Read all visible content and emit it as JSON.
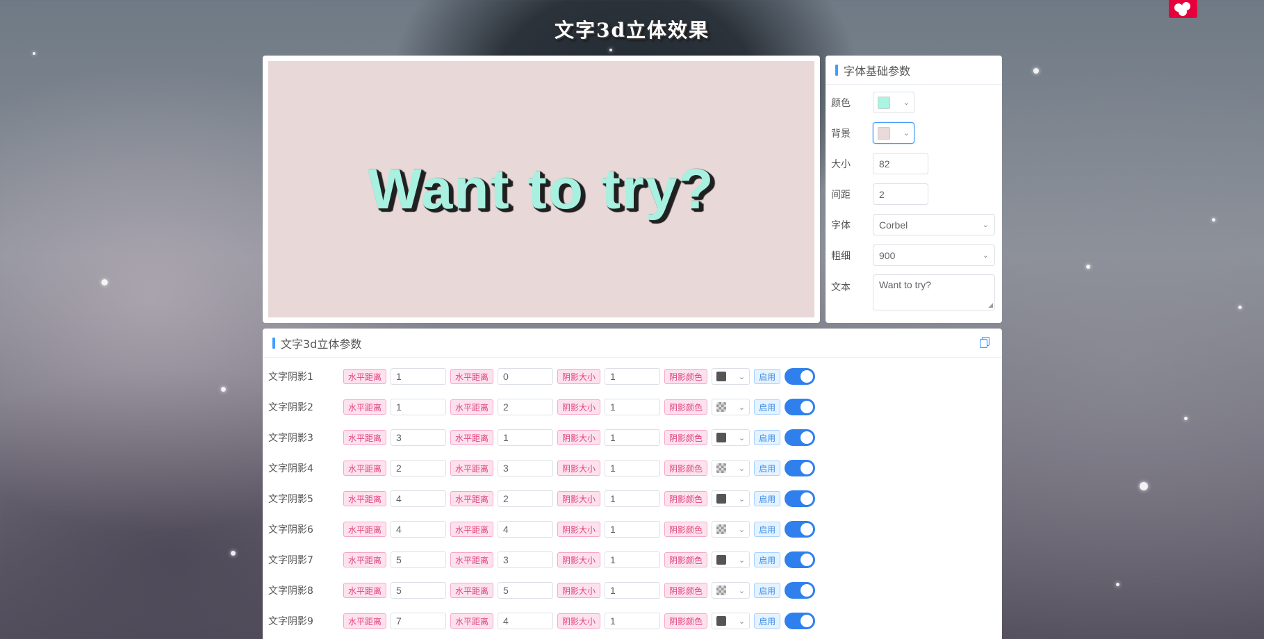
{
  "header": {
    "title": "文字3d立体效果"
  },
  "preview": {
    "text": "Want to try?",
    "text_color": "#a8f0e0",
    "background_color": "#e9d8d8",
    "shadow_color": "#222222"
  },
  "settings": {
    "title": "字体基础参数",
    "color_label": "颜色",
    "color_value": "#a8f5e2",
    "background_label": "背景",
    "background_value": "#ead9d9",
    "size_label": "大小",
    "size_value": "82",
    "spacing_label": "间距",
    "spacing_value": "2",
    "font_label": "字体",
    "font_value": "Corbel",
    "weight_label": "粗细",
    "weight_value": "900",
    "text_label": "文本",
    "text_value": "Want to try?"
  },
  "shadows": {
    "title": "文字3d立体参数",
    "h_tag": "水平距离",
    "v_tag": "水平距离",
    "size_tag": "阴影大小",
    "color_tag": "阴影颜色",
    "enable_tag": "启用",
    "rows": [
      {
        "label": "文字阴影1",
        "h": "1",
        "v": "0",
        "size": "1",
        "swatch": "dark",
        "enabled": true
      },
      {
        "label": "文字阴影2",
        "h": "1",
        "v": "2",
        "size": "1",
        "swatch": "checker",
        "enabled": true
      },
      {
        "label": "文字阴影3",
        "h": "3",
        "v": "1",
        "size": "1",
        "swatch": "dark",
        "enabled": true
      },
      {
        "label": "文字阴影4",
        "h": "2",
        "v": "3",
        "size": "1",
        "swatch": "checker",
        "enabled": true
      },
      {
        "label": "文字阴影5",
        "h": "4",
        "v": "2",
        "size": "1",
        "swatch": "dark",
        "enabled": true
      },
      {
        "label": "文字阴影6",
        "h": "4",
        "v": "4",
        "size": "1",
        "swatch": "checker",
        "enabled": true
      },
      {
        "label": "文字阴影7",
        "h": "5",
        "v": "3",
        "size": "1",
        "swatch": "dark",
        "enabled": true
      },
      {
        "label": "文字阴影8",
        "h": "5",
        "v": "5",
        "size": "1",
        "swatch": "checker",
        "enabled": true
      },
      {
        "label": "文字阴影9",
        "h": "7",
        "v": "4",
        "size": "1",
        "swatch": "dark",
        "enabled": true
      }
    ]
  }
}
